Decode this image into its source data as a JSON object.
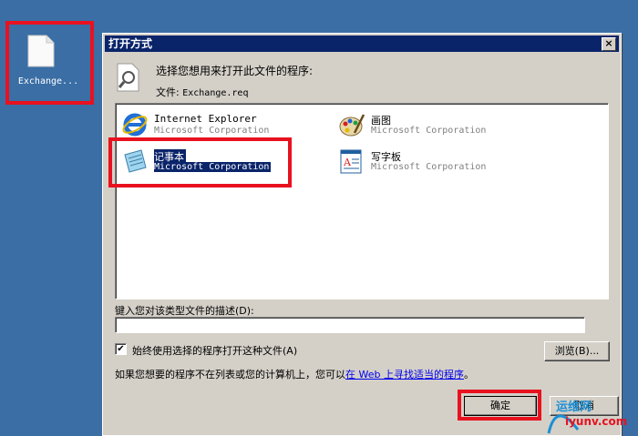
{
  "desktop": {
    "file_label": "Exchange..."
  },
  "dialog": {
    "title": "打开方式",
    "close_label": "×",
    "prompt": "选择您想用来打开此文件的程序:",
    "file_prefix": "文件:",
    "file_name": "Exchange.req",
    "programs": [
      {
        "name": "Internet Explorer",
        "corp": "Microsoft Corporation",
        "icon": "internet-explorer-icon"
      },
      {
        "name": "画图",
        "corp": "Microsoft Corporation",
        "icon": "paint-icon"
      },
      {
        "name": "记事本",
        "corp": "Microsoft Corporation",
        "icon": "notepad-icon"
      },
      {
        "name": "写字板",
        "corp": "Microsoft Corporation",
        "icon": "wordpad-icon"
      }
    ],
    "desc_label": "键入您对该类型文件的描述(D):",
    "desc_value": "",
    "always_use_label": "始终使用选择的程序打开这种文件(A)",
    "always_use_checked": "✔",
    "browse_label": "浏览(B)...",
    "hint_text": "如果您想要的程序不在列表或您的计算机上，您可以",
    "hint_link": "在 Web 上寻找适当的程序",
    "hint_end": "。",
    "ok_label": "确定",
    "cancel_label": "取消"
  },
  "watermark": {
    "line1": "运维网",
    "line2": "iyunv.com"
  },
  "colors": {
    "desktop": "#3a6ea5",
    "titlebar": "#0a246a",
    "highlight": "#e8111f"
  }
}
